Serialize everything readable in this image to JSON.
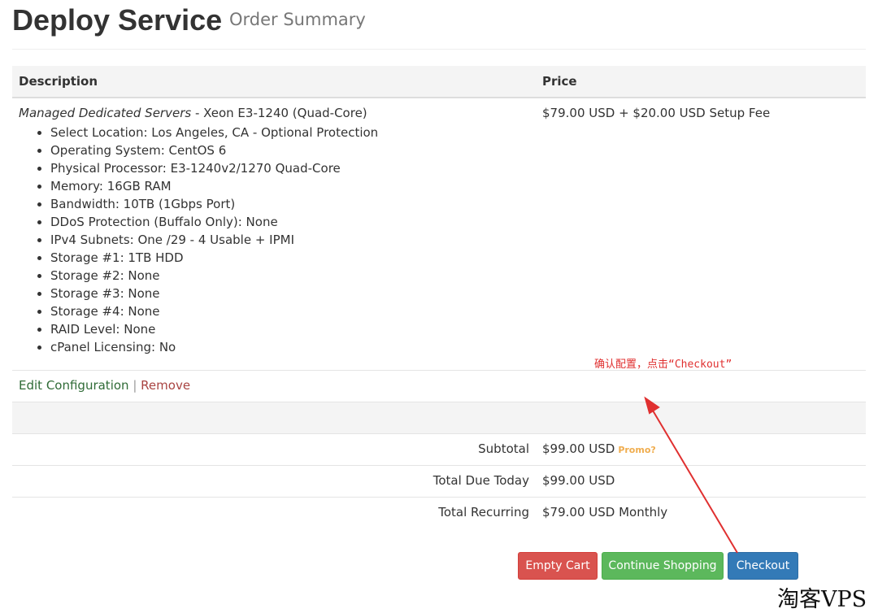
{
  "header": {
    "title": "Deploy Service",
    "subtitle": "Order Summary"
  },
  "table": {
    "columns": [
      "Description",
      "Price"
    ],
    "item": {
      "product_group": "Managed Dedicated Servers",
      "product_name": " - Xeon E3-1240 (Quad-Core)",
      "options": [
        "Select Location: Los Angeles, CA - Optional Protection",
        "Operating System: CentOS 6",
        "Physical Processor: E3-1240v2/1270 Quad-Core",
        "Memory: 16GB RAM",
        "Bandwidth: 10TB (1Gbps Port)",
        "DDoS Protection (Buffalo Only): None",
        "IPv4 Subnets: One /29 - 4 Usable + IPMI",
        "Storage #1: 1TB HDD",
        "Storage #2: None",
        "Storage #3: None",
        "Storage #4: None",
        "RAID Level: None",
        "cPanel Licensing: No"
      ],
      "price": "$79.00 USD + $20.00 USD Setup Fee"
    },
    "actions": {
      "edit_label": "Edit Configuration",
      "separator": "|",
      "remove_label": "Remove"
    }
  },
  "totals": {
    "subtotal_label": "Subtotal",
    "subtotal_value": "$99.00 USD",
    "promo_label": "Promo?",
    "due_today_label": "Total Due Today",
    "due_today_value": "$99.00 USD",
    "recurring_label": "Total Recurring",
    "recurring_value": "$79.00 USD Monthly"
  },
  "buttons": {
    "empty_cart": "Empty Cart",
    "continue_shopping": "Continue Shopping",
    "checkout": "Checkout"
  },
  "annotation": {
    "text": "确认配置，点击“Checkout”"
  },
  "watermark": "淘客VPS",
  "colors": {
    "empty_cart": "#d9534f",
    "continue_shopping": "#5cb85c",
    "checkout": "#337ab7",
    "annotation": "#e03030",
    "promo": "#f0ad4e"
  }
}
